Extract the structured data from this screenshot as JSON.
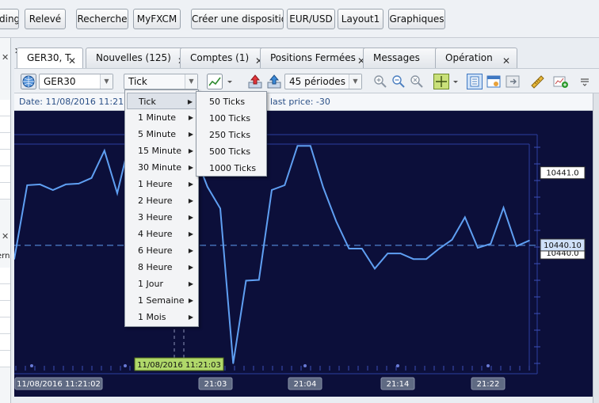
{
  "topbar": {
    "buttons": [
      "ding",
      "Relevé",
      "Recherche",
      "MyFXCM",
      "Créer une disposition",
      "EUR/USD",
      "Layout1",
      "Graphiques"
    ]
  },
  "left_panel": {
    "partial_text": "ern",
    "close_glyph": "✕"
  },
  "tabs": [
    {
      "label": "GER30, T",
      "active": true
    },
    {
      "label": "Nouvelles (125)",
      "active": false
    },
    {
      "label": "Comptes (1)",
      "active": false
    },
    {
      "label": "Positions Fermées",
      "active": false
    },
    {
      "label": "Messages",
      "active": false
    },
    {
      "label": "Opération",
      "active": false
    }
  ],
  "close_glyph": "✕",
  "toolbar": {
    "symbol": "GER30",
    "timeframe": "Tick",
    "periods": "45 périodes",
    "icons": [
      "globe-icon",
      "line-chart-type-icon",
      "buy-order-icon",
      "sell-order-icon",
      "zoom-in-icon",
      "zoom-out-icon",
      "zoom-reset-icon",
      "crosshair-icon",
      "data-window-icon",
      "properties-icon",
      "scroll-end-icon",
      "ruler-icon",
      "add-indicator-icon",
      "menu-icon"
    ]
  },
  "info": {
    "date_label": "Date: 11/08/2016 11:21",
    "last_price": "last price: -30"
  },
  "timeframe_menu": {
    "items": [
      "Tick",
      "1 Minute",
      "5 Minute",
      "15 Minute",
      "30 Minute",
      "1 Heure",
      "2 Heure",
      "3 Heure",
      "4 Heure",
      "6 Heure",
      "8 Heure",
      "1 Jour",
      "1 Semaine",
      "1 Mois"
    ],
    "selected": "Tick"
  },
  "tick_submenu": {
    "items": [
      "50 Ticks",
      "100 Ticks",
      "250 Ticks",
      "500 Ticks",
      "1000 Ticks"
    ]
  },
  "chart_data": {
    "type": "line",
    "colors": {
      "background": "#0c0f3a",
      "line": "#5f9ff2",
      "grid": "#2c3fa0",
      "price_tag": "#ffffff",
      "current_price_tag": "#cfe0f8",
      "time_tag": "#b0d86a"
    },
    "y_ticks": [
      10441.0,
      10440.0
    ],
    "y_range": [
      10438.6,
      10441.5
    ],
    "current_price": 10440.1,
    "current_price_label": "10440.10",
    "y_tick_labels": [
      "10441.0",
      "10440.0"
    ],
    "x_tick_labels": [
      "11/08/2016  11:21:02",
      "21:03",
      "21:04",
      "21:14",
      "21:22"
    ],
    "crosshair_time_label": "11/08/2016 11:21:03",
    "series": [
      {
        "values": [
          10439.93,
          10440.85,
          10440.86,
          10440.79,
          10440.86,
          10440.87,
          10440.94,
          10441.28,
          10440.75,
          10441.42,
          10441.51,
          10441.28,
          10441.18,
          10441.18,
          10441.25,
          10440.83,
          10440.56,
          10438.63,
          10439.66,
          10439.67,
          10440.79,
          10440.85,
          10441.34,
          10441.34,
          10440.82,
          10440.4,
          10440.06,
          10440.06,
          10439.81,
          10440.0,
          10440.0,
          10439.93,
          10439.93,
          10440.06,
          10440.17,
          10440.45,
          10440.07,
          10440.12,
          10440.57,
          10440.09,
          10440.16
        ]
      }
    ]
  }
}
